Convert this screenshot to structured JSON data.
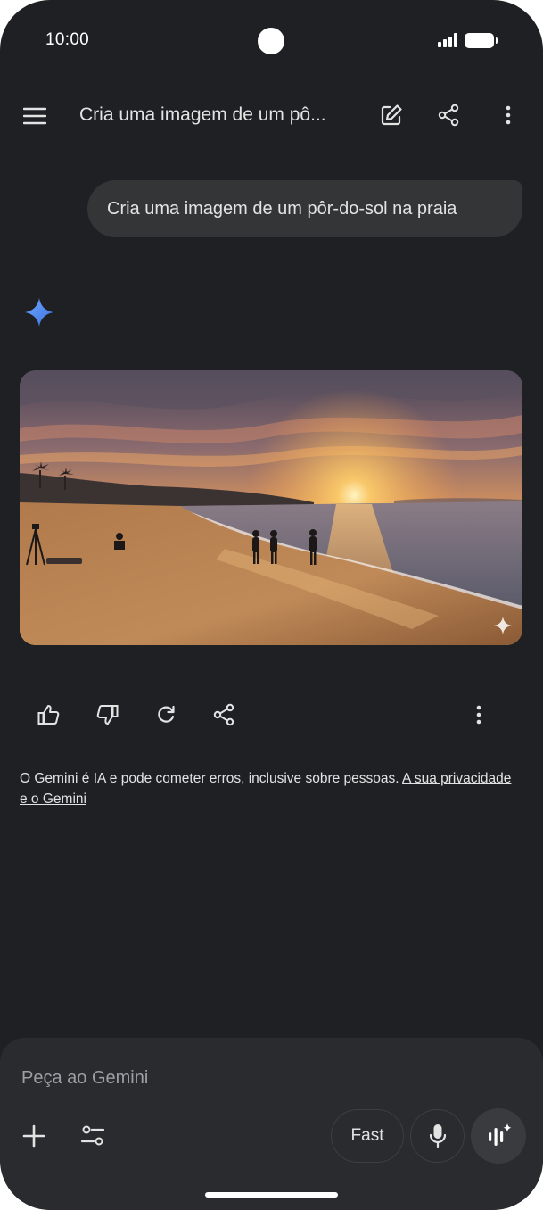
{
  "status_bar": {
    "time": "10:00"
  },
  "header": {
    "title": "Cria uma imagem de um pô...",
    "menu_icon": "hamburger-menu-icon",
    "edit_icon": "edit-new-chat-icon",
    "share_icon": "share-icon",
    "more_icon": "more-vert-icon"
  },
  "chat": {
    "user_message": "Cria uma imagem de um pôr-do-sol na praia",
    "response_icon": "gemini-spark-icon",
    "image_alt": "sunset-beach-image",
    "actions": [
      "thumbs-up-icon",
      "thumbs-down-icon",
      "regenerate-icon",
      "share-icon",
      "more-vert-icon"
    ]
  },
  "disclaimer": {
    "text": "O Gemini é IA e pode cometer erros, inclusive sobre pessoas. ",
    "link": "A sua privacidade e o Gemini"
  },
  "composer": {
    "placeholder": "Peça ao Gemini",
    "model_button": "Fast",
    "plus_icon": "plus-icon",
    "tools_icon": "tools-sliders-icon",
    "mic_icon": "microphone-icon",
    "live_icon": "gemini-live-icon"
  },
  "colors": {
    "background": "#1f2023",
    "bubble": "#333537",
    "composer": "#2a2b2e",
    "accent": "#4c8df6"
  }
}
